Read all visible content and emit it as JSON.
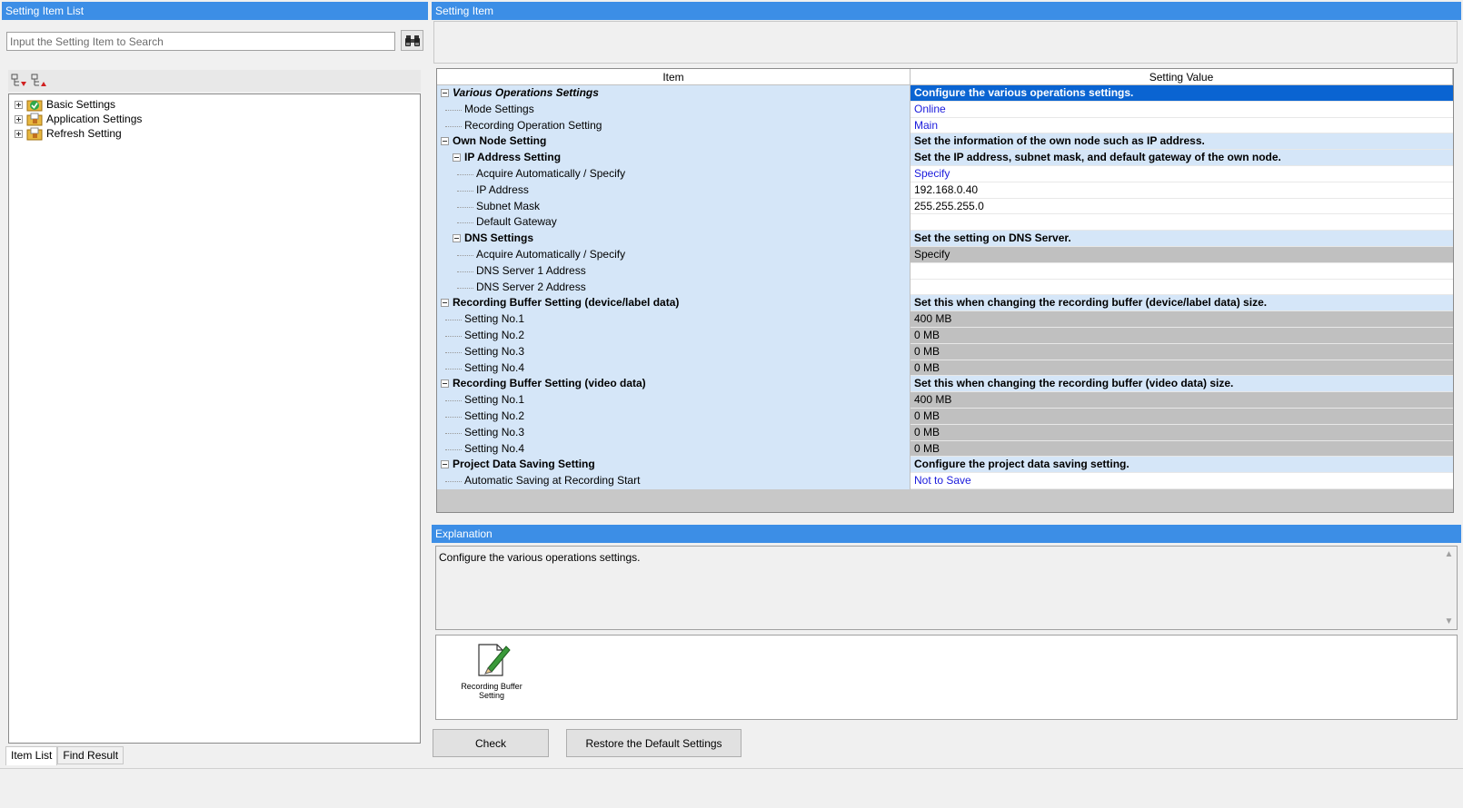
{
  "left_pane": {
    "title": "Setting Item List",
    "search_placeholder": "Input the Setting Item to Search",
    "tree": [
      {
        "label": "Basic Settings",
        "icon": "checked-folder-icon"
      },
      {
        "label": "Application Settings",
        "icon": "folder-icon"
      },
      {
        "label": "Refresh Setting",
        "icon": "folder-icon"
      }
    ],
    "tabs": [
      "Item List",
      "Find Result"
    ]
  },
  "right_pane": {
    "title": "Setting Item",
    "grid_headers": {
      "item": "Item",
      "value": "Setting Value"
    },
    "rows": [
      {
        "item": "Various Operations Settings",
        "value": "Configure the various operations settings.",
        "kind": "group0",
        "style": "selected"
      },
      {
        "item": "Mode Settings",
        "value": "Online",
        "kind": "child1",
        "style": "link"
      },
      {
        "item": "Recording Operation Setting",
        "value": "Main",
        "kind": "child1",
        "style": "link"
      },
      {
        "item": "Own Node Setting",
        "value": "Set the information of the own node such as IP address.",
        "kind": "group0",
        "style": "header"
      },
      {
        "item": "IP Address Setting",
        "value": "Set the IP address, subnet mask, and default gateway of the own node.",
        "kind": "group1",
        "style": "header"
      },
      {
        "item": "Acquire Automatically / Specify",
        "value": "Specify",
        "kind": "child2",
        "style": "link"
      },
      {
        "item": "IP Address",
        "value": "192.168.0.40",
        "kind": "child2",
        "style": "plain"
      },
      {
        "item": "Subnet Mask",
        "value": "255.255.255.0",
        "kind": "child2",
        "style": "plain"
      },
      {
        "item": "Default Gateway",
        "value": "",
        "kind": "child2",
        "style": "plain"
      },
      {
        "item": "DNS Settings",
        "value": "Set the setting on DNS Server.",
        "kind": "group1",
        "style": "header"
      },
      {
        "item": "Acquire Automatically / Specify",
        "value": "Specify",
        "kind": "child2",
        "style": "grey"
      },
      {
        "item": "DNS Server 1 Address",
        "value": "",
        "kind": "child2",
        "style": "plain"
      },
      {
        "item": "DNS Server 2 Address",
        "value": "",
        "kind": "child2",
        "style": "plain"
      },
      {
        "item": "Recording Buffer Setting (device/label data)",
        "value": "Set this when changing the recording buffer (device/label data) size.",
        "kind": "group0",
        "style": "header"
      },
      {
        "item": "Setting No.1",
        "value": "400 MB",
        "kind": "child1",
        "style": "grey"
      },
      {
        "item": "Setting No.2",
        "value": "0 MB",
        "kind": "child1",
        "style": "grey"
      },
      {
        "item": "Setting No.3",
        "value": "0 MB",
        "kind": "child1",
        "style": "grey"
      },
      {
        "item": "Setting No.4",
        "value": "0 MB",
        "kind": "child1",
        "style": "grey"
      },
      {
        "item": "Recording Buffer Setting (video data)",
        "value": "Set this when changing the recording buffer (video data) size.",
        "kind": "group0",
        "style": "header"
      },
      {
        "item": "Setting No.1",
        "value": "400 MB",
        "kind": "child1",
        "style": "grey"
      },
      {
        "item": "Setting No.2",
        "value": "0 MB",
        "kind": "child1",
        "style": "grey"
      },
      {
        "item": "Setting No.3",
        "value": "0 MB",
        "kind": "child1",
        "style": "grey"
      },
      {
        "item": "Setting No.4",
        "value": "0 MB",
        "kind": "child1",
        "style": "grey"
      },
      {
        "item": "Project Data Saving Setting",
        "value": "Configure the project data saving setting.",
        "kind": "group0",
        "style": "header"
      },
      {
        "item": "Automatic Saving at Recording Start",
        "value": "Not to Save",
        "kind": "child1",
        "style": "link"
      }
    ],
    "explanation_title": "Explanation",
    "explanation_text": "Configure the various operations settings.",
    "shortcut_icon": {
      "label": "Recording Buffer Setting",
      "icon": "pencil-document-icon"
    },
    "buttons": {
      "check": "Check",
      "restore": "Restore the Default Settings"
    }
  },
  "colors": {
    "title_bar": "#3c8ee6",
    "selection": "#0a64d2",
    "item_column": "#d5e6f8",
    "link": "#1a1adc",
    "disabled_value": "#c0c0c0"
  }
}
